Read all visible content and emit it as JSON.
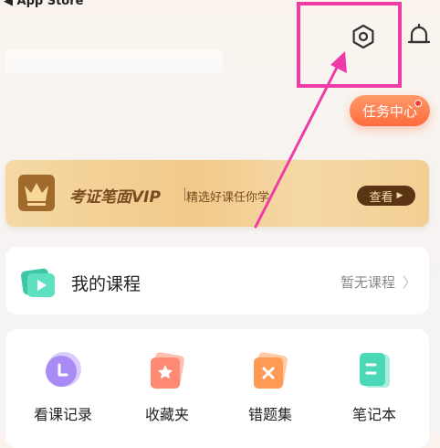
{
  "status_bar": {
    "back_label": "◀ App Store"
  },
  "header": {
    "task_center_label": "任务中心"
  },
  "vip_banner": {
    "title": "考证笔面VIP",
    "subtitle": "精选好课任你学",
    "button_label": "查看"
  },
  "my_courses": {
    "title": "我的课程",
    "status": "暂无课程"
  },
  "tools": [
    {
      "label": "看课记录",
      "icon": "clock-icon",
      "color": "#a98bf5"
    },
    {
      "label": "收藏夹",
      "icon": "star-icon",
      "color": "#ff8a73"
    },
    {
      "label": "错题集",
      "icon": "x-icon",
      "color": "#ff9a55"
    },
    {
      "label": "笔记本",
      "icon": "notebook-icon",
      "color": "#4ad8b6"
    }
  ],
  "colors": {
    "highlight": "#ef3ba7",
    "accent": "#ff6b3d",
    "vip_dark": "#5a3413"
  }
}
